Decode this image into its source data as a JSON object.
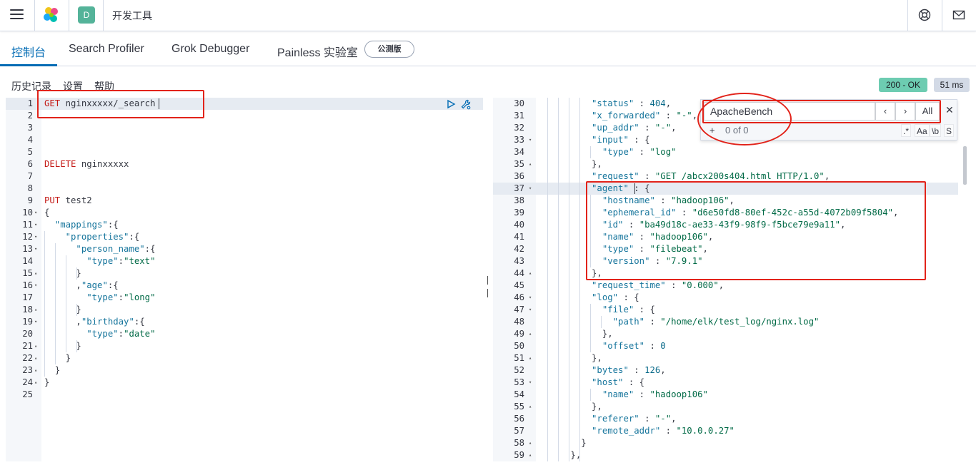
{
  "header": {
    "space_initial": "D",
    "app_title": "开发工具"
  },
  "tabs": [
    {
      "label": "控制台"
    },
    {
      "label": "Search Profiler"
    },
    {
      "label": "Grok Debugger"
    },
    {
      "label": "Painless 实验室"
    }
  ],
  "beta_badge": "公测版",
  "toolbar": {
    "history": "历史记录",
    "settings": "设置",
    "help": "帮助",
    "status": "200 - OK",
    "time": "51 ms"
  },
  "search": {
    "value": "ApacheBench",
    "prev": "‹",
    "next": "›",
    "all": "All",
    "close": "✕",
    "plus": "+",
    "count": "0 of 0",
    "opt_regex": ".*",
    "opt_case": "Aa",
    "opt_word": "\\b",
    "opt_selection": "S"
  },
  "left_lines": [
    {
      "n": "1",
      "fold": "",
      "tokens": [
        {
          "c": "kw",
          "t": "GET"
        },
        {
          "c": "url",
          "t": " nginxxxxx/_search"
        }
      ]
    },
    {
      "n": "2",
      "fold": "",
      "tokens": []
    },
    {
      "n": "3",
      "fold": "",
      "tokens": []
    },
    {
      "n": "4",
      "fold": "",
      "tokens": []
    },
    {
      "n": "5",
      "fold": "",
      "tokens": []
    },
    {
      "n": "6",
      "fold": "",
      "tokens": [
        {
          "c": "kw",
          "t": "DELETE"
        },
        {
          "c": "url",
          "t": " nginxxxxx"
        }
      ]
    },
    {
      "n": "7",
      "fold": "",
      "tokens": []
    },
    {
      "n": "8",
      "fold": "",
      "tokens": []
    },
    {
      "n": "9",
      "fold": "",
      "tokens": [
        {
          "c": "kw",
          "t": "PUT"
        },
        {
          "c": "url",
          "t": " test2"
        }
      ]
    },
    {
      "n": "10",
      "fold": "▾",
      "tokens": [
        {
          "c": "punct",
          "t": "{"
        }
      ]
    },
    {
      "n": "11",
      "fold": "▾",
      "tokens": [
        {
          "c": "key",
          "t": "  \"mappings\""
        },
        {
          "c": "punct",
          "t": ":{"
        }
      ]
    },
    {
      "n": "12",
      "fold": "▾",
      "tokens": [
        {
          "c": "key",
          "t": "    \"properties\""
        },
        {
          "c": "punct",
          "t": ":{"
        }
      ]
    },
    {
      "n": "13",
      "fold": "▾",
      "tokens": [
        {
          "c": "key",
          "t": "      \"person_name\""
        },
        {
          "c": "punct",
          "t": ":{"
        }
      ]
    },
    {
      "n": "14",
      "fold": "",
      "tokens": [
        {
          "c": "key",
          "t": "        \"type\""
        },
        {
          "c": "punct",
          "t": ":"
        },
        {
          "c": "str",
          "t": "\"text\""
        }
      ]
    },
    {
      "n": "15",
      "fold": "▴",
      "tokens": [
        {
          "c": "punct",
          "t": "      }"
        }
      ]
    },
    {
      "n": "16",
      "fold": "▾",
      "tokens": [
        {
          "c": "punct",
          "t": "      ,"
        },
        {
          "c": "key",
          "t": "\"age\""
        },
        {
          "c": "punct",
          "t": ":{"
        }
      ]
    },
    {
      "n": "17",
      "fold": "",
      "tokens": [
        {
          "c": "key",
          "t": "        \"type\""
        },
        {
          "c": "punct",
          "t": ":"
        },
        {
          "c": "str",
          "t": "\"long\""
        }
      ]
    },
    {
      "n": "18",
      "fold": "▴",
      "tokens": [
        {
          "c": "punct",
          "t": "      }"
        }
      ]
    },
    {
      "n": "19",
      "fold": "▾",
      "tokens": [
        {
          "c": "punct",
          "t": "      ,"
        },
        {
          "c": "key",
          "t": "\"birthday\""
        },
        {
          "c": "punct",
          "t": ":{"
        }
      ]
    },
    {
      "n": "20",
      "fold": "",
      "tokens": [
        {
          "c": "key",
          "t": "        \"type\""
        },
        {
          "c": "punct",
          "t": ":"
        },
        {
          "c": "str",
          "t": "\"date\""
        }
      ]
    },
    {
      "n": "21",
      "fold": "▴",
      "tokens": [
        {
          "c": "punct",
          "t": "      }"
        }
      ]
    },
    {
      "n": "22",
      "fold": "▴",
      "tokens": [
        {
          "c": "punct",
          "t": "    }"
        }
      ]
    },
    {
      "n": "23",
      "fold": "▴",
      "tokens": [
        {
          "c": "punct",
          "t": "  }"
        }
      ]
    },
    {
      "n": "24",
      "fold": "▴",
      "tokens": [
        {
          "c": "punct",
          "t": "}"
        }
      ]
    },
    {
      "n": "25",
      "fold": "",
      "tokens": []
    }
  ],
  "right_lines": [
    {
      "n": "30",
      "fold": "",
      "tokens": [
        {
          "c": "key",
          "t": "          \"status\""
        },
        {
          "c": "punct",
          "t": " : "
        },
        {
          "c": "num",
          "t": "404"
        },
        {
          "c": "punct",
          "t": ","
        }
      ]
    },
    {
      "n": "31",
      "fold": "",
      "tokens": [
        {
          "c": "key",
          "t": "          \"x_forwarded\""
        },
        {
          "c": "punct",
          "t": " : "
        },
        {
          "c": "str",
          "t": "\"-\""
        },
        {
          "c": "punct",
          "t": ","
        }
      ]
    },
    {
      "n": "32",
      "fold": "",
      "tokens": [
        {
          "c": "key",
          "t": "          \"up_addr\""
        },
        {
          "c": "punct",
          "t": " : "
        },
        {
          "c": "str",
          "t": "\"-\""
        },
        {
          "c": "punct",
          "t": ","
        }
      ]
    },
    {
      "n": "33",
      "fold": "▾",
      "tokens": [
        {
          "c": "key",
          "t": "          \"input\""
        },
        {
          "c": "punct",
          "t": " : {"
        }
      ]
    },
    {
      "n": "34",
      "fold": "",
      "tokens": [
        {
          "c": "key",
          "t": "            \"type\""
        },
        {
          "c": "punct",
          "t": " : "
        },
        {
          "c": "str",
          "t": "\"log\""
        }
      ]
    },
    {
      "n": "35",
      "fold": "▴",
      "tokens": [
        {
          "c": "punct",
          "t": "          },"
        }
      ]
    },
    {
      "n": "36",
      "fold": "",
      "tokens": [
        {
          "c": "key",
          "t": "          \"request\""
        },
        {
          "c": "punct",
          "t": " : "
        },
        {
          "c": "str",
          "t": "\"GET /abcx200s404.html HTTP/1.0\""
        },
        {
          "c": "punct",
          "t": ","
        }
      ]
    },
    {
      "n": "37",
      "fold": "▾",
      "tokens": [
        {
          "c": "key",
          "t": "          \"agent\""
        },
        {
          "c": "punct",
          "t": " : {"
        }
      ]
    },
    {
      "n": "38",
      "fold": "",
      "tokens": [
        {
          "c": "key",
          "t": "            \"hostname\""
        },
        {
          "c": "punct",
          "t": " : "
        },
        {
          "c": "str",
          "t": "\"hadoop106\""
        },
        {
          "c": "punct",
          "t": ","
        }
      ]
    },
    {
      "n": "39",
      "fold": "",
      "tokens": [
        {
          "c": "key",
          "t": "            \"ephemeral_id\""
        },
        {
          "c": "punct",
          "t": " : "
        },
        {
          "c": "str",
          "t": "\"d6e50fd8-80ef-452c-a55d-4072b09f5804\""
        },
        {
          "c": "punct",
          "t": ","
        }
      ]
    },
    {
      "n": "40",
      "fold": "",
      "tokens": [
        {
          "c": "key",
          "t": "            \"id\""
        },
        {
          "c": "punct",
          "t": " : "
        },
        {
          "c": "str",
          "t": "\"ba49d18c-ae33-43f9-98f9-f5bce79e9a11\""
        },
        {
          "c": "punct",
          "t": ","
        }
      ]
    },
    {
      "n": "41",
      "fold": "",
      "tokens": [
        {
          "c": "key",
          "t": "            \"name\""
        },
        {
          "c": "punct",
          "t": " : "
        },
        {
          "c": "str",
          "t": "\"hadoop106\""
        },
        {
          "c": "punct",
          "t": ","
        }
      ]
    },
    {
      "n": "42",
      "fold": "",
      "tokens": [
        {
          "c": "key",
          "t": "            \"type\""
        },
        {
          "c": "punct",
          "t": " : "
        },
        {
          "c": "str",
          "t": "\"filebeat\""
        },
        {
          "c": "punct",
          "t": ","
        }
      ]
    },
    {
      "n": "43",
      "fold": "",
      "tokens": [
        {
          "c": "key",
          "t": "            \"version\""
        },
        {
          "c": "punct",
          "t": " : "
        },
        {
          "c": "str",
          "t": "\"7.9.1\""
        }
      ]
    },
    {
      "n": "44",
      "fold": "▴",
      "tokens": [
        {
          "c": "punct",
          "t": "          },"
        }
      ]
    },
    {
      "n": "45",
      "fold": "",
      "tokens": [
        {
          "c": "key",
          "t": "          \"request_time\""
        },
        {
          "c": "punct",
          "t": " : "
        },
        {
          "c": "str",
          "t": "\"0.000\""
        },
        {
          "c": "punct",
          "t": ","
        }
      ]
    },
    {
      "n": "46",
      "fold": "▾",
      "tokens": [
        {
          "c": "key",
          "t": "          \"log\""
        },
        {
          "c": "punct",
          "t": " : {"
        }
      ]
    },
    {
      "n": "47",
      "fold": "▾",
      "tokens": [
        {
          "c": "key",
          "t": "            \"file\""
        },
        {
          "c": "punct",
          "t": " : {"
        }
      ]
    },
    {
      "n": "48",
      "fold": "",
      "tokens": [
        {
          "c": "key",
          "t": "              \"path\""
        },
        {
          "c": "punct",
          "t": " : "
        },
        {
          "c": "str",
          "t": "\"/home/elk/test_log/nginx.log\""
        }
      ]
    },
    {
      "n": "49",
      "fold": "▴",
      "tokens": [
        {
          "c": "punct",
          "t": "            },"
        }
      ]
    },
    {
      "n": "50",
      "fold": "",
      "tokens": [
        {
          "c": "key",
          "t": "            \"offset\""
        },
        {
          "c": "punct",
          "t": " : "
        },
        {
          "c": "num",
          "t": "0"
        }
      ]
    },
    {
      "n": "51",
      "fold": "▴",
      "tokens": [
        {
          "c": "punct",
          "t": "          },"
        }
      ]
    },
    {
      "n": "52",
      "fold": "",
      "tokens": [
        {
          "c": "key",
          "t": "          \"bytes\""
        },
        {
          "c": "punct",
          "t": " : "
        },
        {
          "c": "num",
          "t": "126"
        },
        {
          "c": "punct",
          "t": ","
        }
      ]
    },
    {
      "n": "53",
      "fold": "▾",
      "tokens": [
        {
          "c": "key",
          "t": "          \"host\""
        },
        {
          "c": "punct",
          "t": " : {"
        }
      ]
    },
    {
      "n": "54",
      "fold": "",
      "tokens": [
        {
          "c": "key",
          "t": "            \"name\""
        },
        {
          "c": "punct",
          "t": " : "
        },
        {
          "c": "str",
          "t": "\"hadoop106\""
        }
      ]
    },
    {
      "n": "55",
      "fold": "▴",
      "tokens": [
        {
          "c": "punct",
          "t": "          },"
        }
      ]
    },
    {
      "n": "56",
      "fold": "",
      "tokens": [
        {
          "c": "key",
          "t": "          \"referer\""
        },
        {
          "c": "punct",
          "t": " : "
        },
        {
          "c": "str",
          "t": "\"-\""
        },
        {
          "c": "punct",
          "t": ","
        }
      ]
    },
    {
      "n": "57",
      "fold": "",
      "tokens": [
        {
          "c": "key",
          "t": "          \"remote_addr\""
        },
        {
          "c": "punct",
          "t": " : "
        },
        {
          "c": "str",
          "t": "\"10.0.0.27\""
        }
      ]
    },
    {
      "n": "58",
      "fold": "▴",
      "tokens": [
        {
          "c": "punct",
          "t": "        }"
        }
      ]
    },
    {
      "n": "59",
      "fold": "▴",
      "tokens": [
        {
          "c": "punct",
          "t": "      },"
        }
      ]
    }
  ],
  "colors": {
    "accent": "#006bb4",
    "status_ok": "#6dccb1",
    "highlight": "#e2231a",
    "space_badge": "#54b399"
  }
}
